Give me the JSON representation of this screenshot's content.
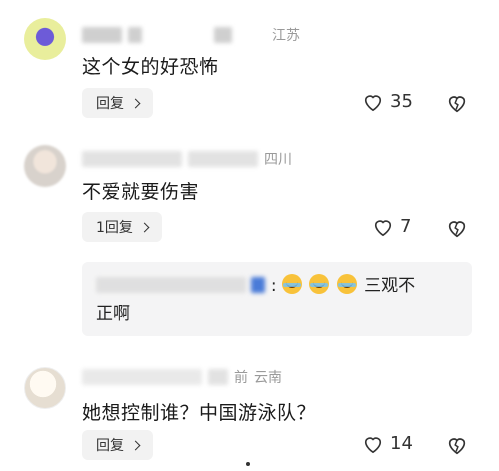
{
  "comments": [
    {
      "region": "江苏",
      "text": "这个女的好恐怖",
      "reply_label": "回复",
      "likes": "35"
    },
    {
      "region": "四川",
      "text": "不爱就要伤害",
      "reply_label": "1回复",
      "likes": "7",
      "quote_line1_suffix": "三观不",
      "quote_line2": "正啊"
    },
    {
      "meta_time": "前",
      "region": "云南",
      "text": "她想控制谁？中国游泳队？",
      "reply_label": "回复",
      "likes": "14"
    }
  ],
  "icons": {
    "like": "heart-outline-icon",
    "dislike": "broken-heart-outline-icon",
    "reply_chevron": "chevron-right-icon",
    "emoji": "laughing-crying-emoji-icon"
  },
  "colors": {
    "reply_bg": "#f2f2f2",
    "quote_bg": "#f4f4f5",
    "meta_text": "#9a9a9a"
  }
}
